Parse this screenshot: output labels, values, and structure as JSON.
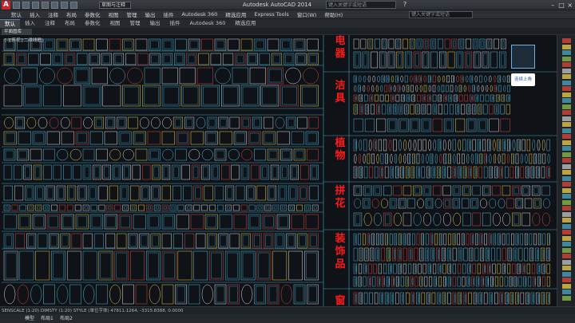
{
  "app": {
    "logo": "A",
    "title": "Autodesk AutoCAD 2014",
    "workspace": "草图与注释",
    "search_placeholder": "键入关键字或短语",
    "help": "?"
  },
  "menu": [
    "默认",
    "插入",
    "注释",
    "布局",
    "参数化",
    "视图",
    "管理",
    "输出",
    "插件",
    "Autodesk 360",
    "精选应用",
    "Express Tools",
    "窗口(W)",
    "帮助(H)"
  ],
  "ribbon_tabs": [
    "默认",
    "插入",
    "注释",
    "布局",
    "参数化",
    "视图",
    "管理",
    "输出",
    "插件",
    "Autodesk 360",
    "精选应用"
  ],
  "document_tab": "平面图库",
  "view_label": "[-][俯视][二维线框]",
  "categories": [
    "电",
    "器",
    "洁",
    "具",
    "植",
    "物",
    "拼",
    "花",
    "装",
    "饰",
    "品",
    "窗"
  ],
  "status": {
    "command_line": "SENSCALE (1:20) DIMSTY (1:20) STYLE (单位字体)   47811.1264,  -3315.8388, 0.0000"
  },
  "model_tabs": [
    "模型",
    "布局1",
    "布局2"
  ],
  "nav_label": "连续上角",
  "colors": {
    "accent_blue": "#6cb1e8",
    "drawing_line": "#4aa8c8",
    "category_red": "#ff1a1a",
    "bg": "#0f1318"
  }
}
